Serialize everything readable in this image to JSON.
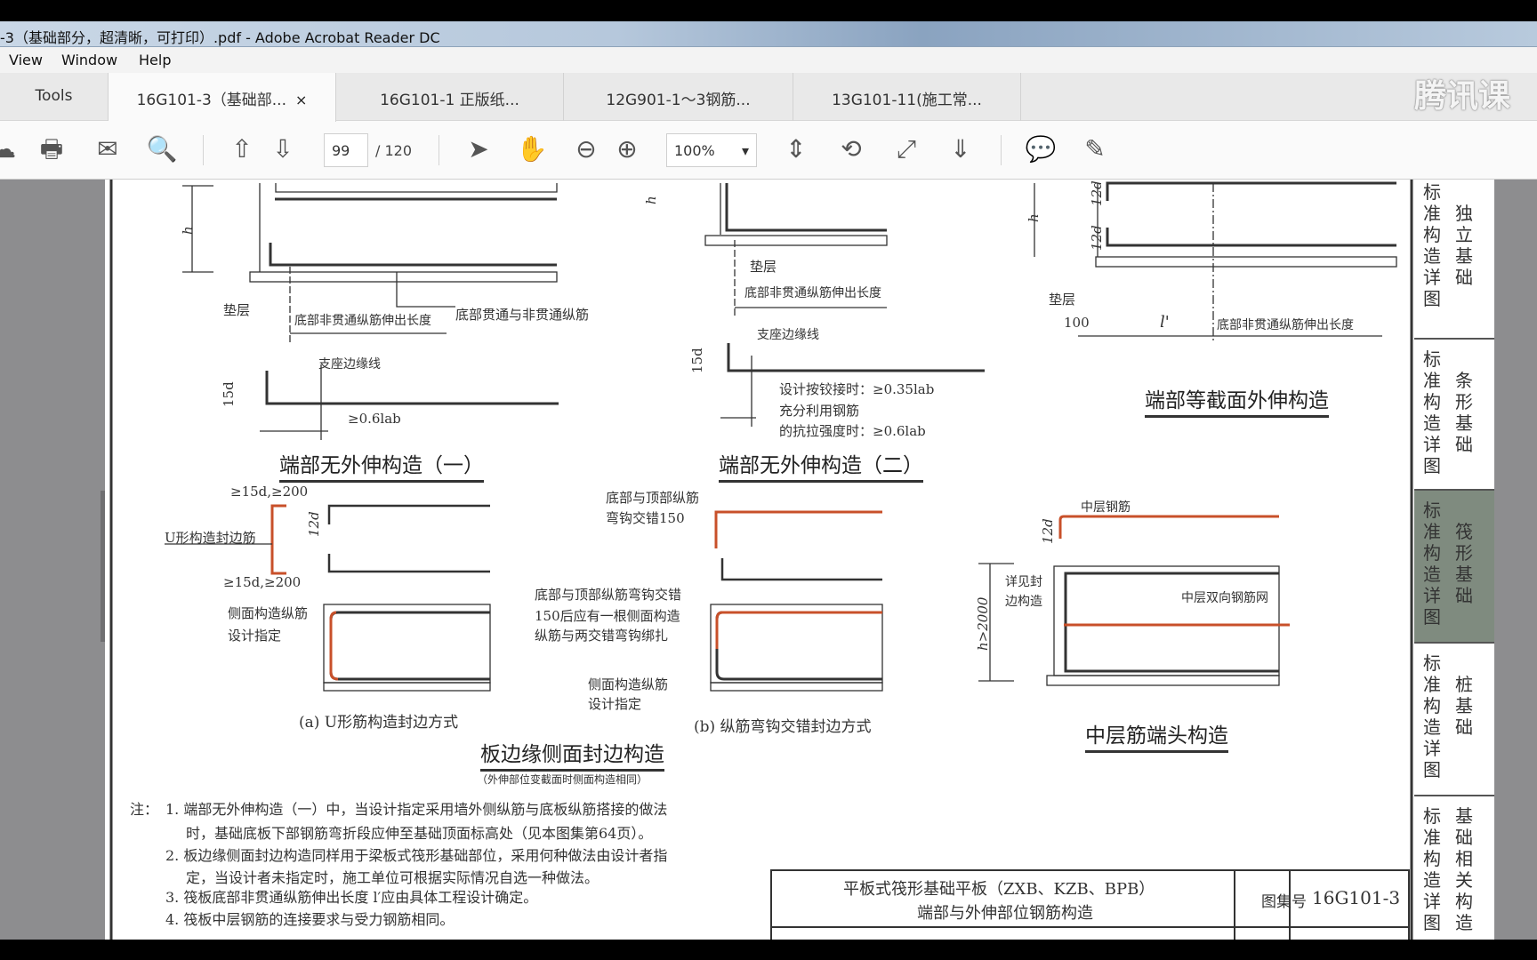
{
  "window": {
    "title": "-3（基础部分，超清晰，可打印）.pdf - Adobe Acrobat Reader DC"
  },
  "menu": [
    "View",
    "Window",
    "Help"
  ],
  "tabs": {
    "tools": "Tools",
    "docs": [
      "16G101-3（基础部...",
      "16G101-1 正版纸...",
      "12G901-1～3钢筋...",
      "13G101-11(施工常..."
    ],
    "close": "×"
  },
  "watermark": "腾讯课",
  "toolbar": {
    "page_current": "99",
    "page_total": "/ 120",
    "zoom": "100%",
    "zoom_arrow": "▾",
    "active_tool": "hand-icon",
    "accent": "#2a7fd4"
  },
  "drawing": {
    "fig1": {
      "caption": "端部无外伸构造（一）",
      "h": "h",
      "cushion": "垫层",
      "ext_len": "底部非贯通纵筋伸出长度",
      "bars": "底部贯通与非贯通纵筋",
      "d15": "15d",
      "edge": "支座边缘线",
      "anchor": "≥0.6lab"
    },
    "fig2": {
      "caption": "端部无外伸构造（二）",
      "h": "h",
      "cushion": "垫层",
      "ext_len": "底部非贯通纵筋伸出长度",
      "edge": "支座边缘线",
      "d15": "15d",
      "l1": "设计按铰接时：≥0.35lab",
      "l2": "充分利用钢筋",
      "l3": "的抗拉强度时：≥0.6lab"
    },
    "fig3": {
      "caption": "端部等截面外伸构造",
      "d12a": "12d",
      "d12b": "12d",
      "h": "h",
      "cushion": "垫层",
      "d100": "100",
      "lp": "l'",
      "ext_len": "底部非贯通纵筋伸出长度"
    },
    "fig4": {
      "caption": "板边缘侧面封边构造",
      "subcaption": "（外伸部位变截面时侧面构造相同）",
      "a": {
        "caption": "(a)  U形筋构造封边方式",
        "top": "≥15d,≥200",
        "bottom": "≥15d,≥200",
        "ubar": "U形构造封边筋",
        "d12": "12d",
        "side1": "侧面构造纵筋",
        "side2": "设计指定"
      },
      "b": {
        "caption": "(b)  纵筋弯钩交错封边方式",
        "n1": "底部与顶部纵筋",
        "n2": "弯钩交错150",
        "m1": "底部与顶部纵筋弯钩交错",
        "m2": "150后应有一根侧面构造",
        "m3": "纵筋与两交错弯钩绑扎",
        "side1": "侧面构造纵筋",
        "side2": "设计指定"
      }
    },
    "fig5": {
      "caption": "中层筋端头构造",
      "mid": "中层钢筋",
      "d12": "12d",
      "see1": "详见封",
      "see2": "边构造",
      "mesh": "中层双向钢筋网",
      "h": "h>2000"
    },
    "rebar_color": "#c8502a"
  },
  "notes": {
    "label": "注：",
    "lines": [
      "1. 端部无外伸构造（一）中，当设计指定采用墙外侧纵筋与底板纵筋搭接的做法",
      "时，基础底板下部钢筋弯折段应伸至基础顶面标高处（见本图集第64页）。",
      "2. 板边缘侧面封边构造同样用于梁板式筏形基础部位，采用何种做法由设计者指",
      "定，当设计者未指定时，施工单位可根据实际情况自选一种做法。",
      "3. 筏板底部非贯通纵筋伸出长度 l′应由具体工程设计确定。",
      "4. 筏板中层钢筋的连接要求与受力钢筋相同。"
    ]
  },
  "titleblock": {
    "line1": "平板式筏形基础平板（ZXB、KZB、BPB）",
    "line2": "端部与外伸部位钢筋构造",
    "set_label": "图集号",
    "set_no": "16G101-3"
  },
  "sidebar": [
    {
      "a": "标准构造详图",
      "b": "独立基础"
    },
    {
      "a": "标准构造详图",
      "b": "条形基础"
    },
    {
      "a": "标准构造详图",
      "b": "筏形基础",
      "selected": true
    },
    {
      "a": "标准构造详图",
      "b": "桩基础"
    },
    {
      "a": "标准构造详图",
      "b": "基础相关构造"
    }
  ]
}
